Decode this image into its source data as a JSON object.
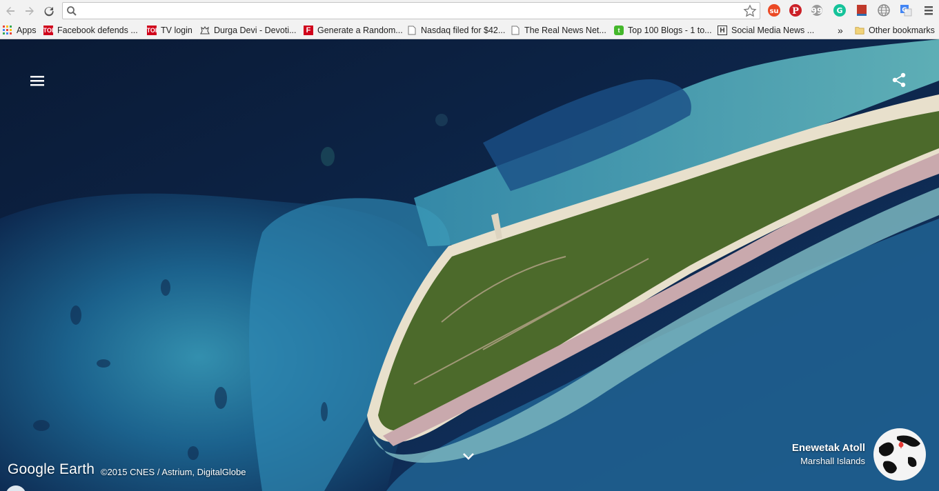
{
  "browser": {
    "url": "",
    "back_icon": "arrow-left-icon",
    "forward_icon": "arrow-right-icon",
    "reload_icon": "reload-icon",
    "bookmark_star_icon": "star-icon",
    "extensions": [
      "stumbleupon-icon",
      "pinterest-icon",
      "quote-icon",
      "grammarly-icon",
      "bookmark-red-icon",
      "globe-icon",
      "translate-icon",
      "chrome-menu-icon"
    ]
  },
  "bookmarks": {
    "apps": "Apps",
    "items": [
      {
        "label": "Facebook defends ...",
        "icon": "toi-icon"
      },
      {
        "label": "TV login",
        "icon": "toi-icon"
      },
      {
        "label": "Durga Devi - Devoti...",
        "icon": "durga-icon"
      },
      {
        "label": "Generate a Random...",
        "icon": "f-icon"
      },
      {
        "label": "Nasdaq filed for $42...",
        "icon": "page-icon"
      },
      {
        "label": "The Real News Net...",
        "icon": "page-icon"
      },
      {
        "label": "Top 100 Blogs - 1 to...",
        "icon": "t-icon"
      },
      {
        "label": "Social Media News ...",
        "icon": "h-icon"
      }
    ],
    "overflow": "»",
    "other": "Other bookmarks"
  },
  "earth": {
    "logo": "Google Earth",
    "copyright": "©2015 CNES / Astrium, DigitalGlobe",
    "place_name": "Enewetak Atoll",
    "place_region": "Marshall Islands",
    "menu_icon": "hamburger-menu-icon",
    "share_icon": "share-icon",
    "expand_icon": "chevron-down-icon"
  },
  "colors": {
    "deep_ocean": "#0b1e3c",
    "lagoon": "#2a8fb0",
    "reef": "#6fc2c9",
    "land": "#4e6a2c",
    "runway": "#c9a9ad",
    "sand": "#e9e1cf"
  }
}
